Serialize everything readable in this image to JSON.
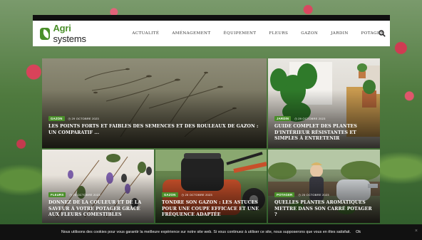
{
  "brand": {
    "name_part1": "Agri",
    "name_part2": " systems",
    "color": "#4a8f2a"
  },
  "nav": {
    "items": [
      {
        "label": "ACTUALITÉ"
      },
      {
        "label": "AMÉNAGEMENT"
      },
      {
        "label": "ÉQUIPEMENT"
      },
      {
        "label": "FLEURS"
      },
      {
        "label": "GAZON"
      },
      {
        "label": "JARDIN"
      },
      {
        "label": "POTAGER"
      }
    ],
    "search_icon": "search-icon"
  },
  "articles": [
    {
      "category": "GAZON",
      "date": "29 OCTOBRE 2023",
      "title": "LES POINTS FORTS ET FAIBLES DES SEMENCES ET DES ROULEAUX DE GAZON : UN COMPARATIF ..."
    },
    {
      "category": "JARDIN",
      "date": "29 OCTOBRE 2023",
      "title": "GUIDE COMPLET DES PLANTES D'INTÉRIEUR RÉSISTANTES ET SIMPLES À ENTRETENIR"
    },
    {
      "category": "FLEURS",
      "date": "25 OCTOBRE 2023",
      "title": "DONNEZ DE LA COULEUR ET DE LA SAVEUR À VOTRE POTAGER GRÂCE AUX FLEURS COMESTIBLES"
    },
    {
      "category": "GAZON",
      "date": "25 OCTOBRE 2023",
      "title": "TONDRE SON GAZON : LES ASTUCES POUR UNE COUPE EFFICACE ET UNE FRÉQUENCE ADAPTÉE"
    },
    {
      "category": "POTAGER",
      "date": "25 OCTOBRE 2023",
      "title": "QUELLES PLANTES AROMATIQUES METTRE DANS SON CARRÉ POTAGER ?"
    }
  ],
  "cookie": {
    "text": "Nous utilisons des cookies pour vous garantir la meilleure expérience sur notre site web. Si vous continuez à utiliser ce site, nous supposerons que vous en êtes satisfait.",
    "ok_label": "Ok",
    "close_label": "×"
  }
}
